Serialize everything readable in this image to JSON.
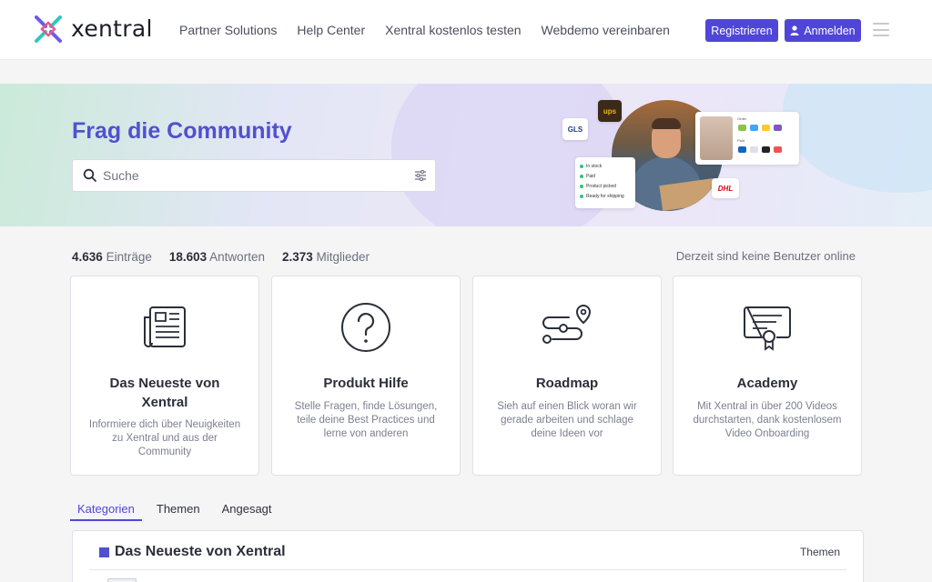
{
  "brand": {
    "name": "xentral",
    "accent": "#4f46d8",
    "title_color": "#5150d0"
  },
  "nav": {
    "links": [
      "Partner Solutions",
      "Help Center",
      "Xentral kostenlos testen",
      "Webdemo vereinbaren"
    ],
    "register_label": "Registrieren",
    "login_label": "Anmelden",
    "menu_icon": "hamburger-icon"
  },
  "hero": {
    "title": "Frag die Community",
    "search_placeholder": "Suche",
    "illustration": {
      "carrier_tags": [
        "GLS",
        "ups",
        "DHL"
      ],
      "status_items": [
        "In stock",
        "Paid",
        "Product picked",
        "Ready for shipping"
      ],
      "shop_labels": [
        "Order",
        "Paid"
      ]
    }
  },
  "stats": {
    "entries_count": "4.636",
    "entries_label": "Einträge",
    "answers_count": "18.603",
    "answers_label": "Antworten",
    "members_count": "2.373",
    "members_label": "Mitglieder",
    "online_text": "Derzeit sind keine Benutzer online"
  },
  "cards": [
    {
      "title": "Das Neueste von Xentral",
      "text": "Informiere dich über Neuigkeiten zu Xentral und aus der Community",
      "icon": "newspaper-icon"
    },
    {
      "title": "Produkt Hilfe",
      "text": "Stelle Fragen, finde Lösungen, teile deine Best Practices und lerne von anderen",
      "icon": "question-circle-icon"
    },
    {
      "title": "Roadmap",
      "text": "Sieh auf einen Blick woran wir gerade arbeiten und schlage deine Ideen vor",
      "icon": "route-pin-icon"
    },
    {
      "title": "Academy",
      "text": "Mit Xentral in über 200 Videos durchstarten, dank kostenlosem Video Onboarding",
      "icon": "certificate-icon"
    }
  ],
  "tabs": [
    {
      "label": "Kategorien",
      "active": true
    },
    {
      "label": "Themen",
      "active": false
    },
    {
      "label": "Angesagt",
      "active": false
    }
  ],
  "category_panel": {
    "title": "Das Neueste von Xentral",
    "column_label": "Themen"
  }
}
